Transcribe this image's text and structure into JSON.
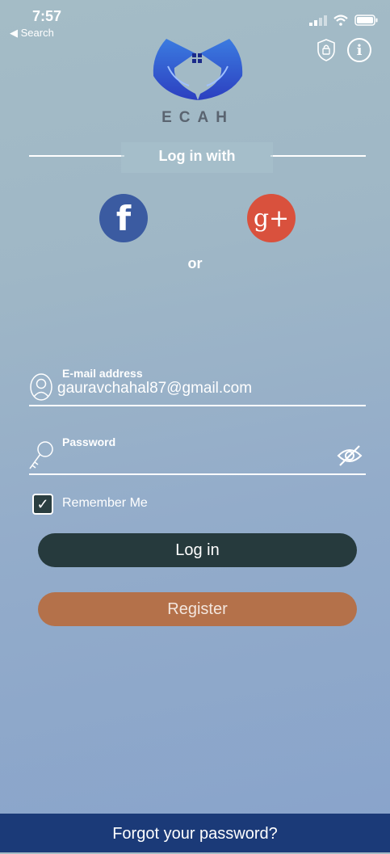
{
  "status_bar": {
    "time": "7:57",
    "back_label": "◀ Search"
  },
  "header": {
    "logo_text": "ECAH",
    "info_icon": "i"
  },
  "social": {
    "heading": "Log in with",
    "facebook_glyph": "f",
    "google_glyph": "g+",
    "or_label": "or"
  },
  "form": {
    "email_label": "E-mail address",
    "email_value": "gauravchahal87@gmail.com",
    "password_label": "Password",
    "password_value": "",
    "remember_label": "Remember Me",
    "remember_checked": true
  },
  "buttons": {
    "login": "Log in",
    "register": "Register"
  },
  "footer": {
    "forgot": "Forgot your password?"
  },
  "colors": {
    "login_btn": "#263a3d",
    "register_btn": "#b4714a",
    "footer_bg": "#1b3a78",
    "facebook": "#3b5ba1",
    "google": "#d9513d"
  }
}
